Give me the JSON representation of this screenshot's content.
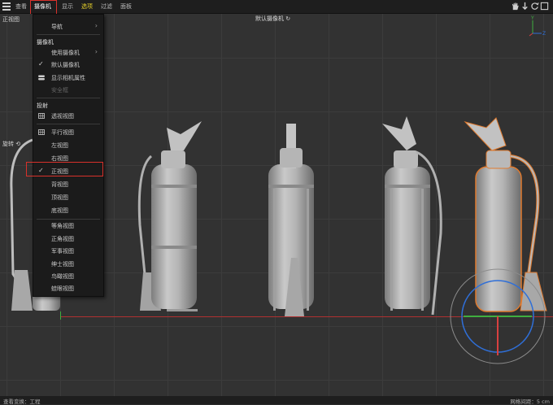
{
  "menubar": {
    "items": [
      "查看",
      "摄像机",
      "显示",
      "选项",
      "过滤",
      "面板"
    ],
    "active_index": 1
  },
  "viewport": {
    "view_name": "正视图",
    "camera_name": "默认摄像机",
    "rotate_label": "旋转",
    "gizmo_y": "Y",
    "gizmo_z": "Z"
  },
  "dropdown": {
    "nav": "导航",
    "camera_header": "摄像机",
    "use_camera": "使用摄像机",
    "default_camera": "默认摄像机",
    "show_camera_props": "显示相机属性",
    "safe_frame": "安全框",
    "projection_header": "投射",
    "perspective": "透视视图",
    "parallel": "平行视图",
    "left": "左视图",
    "right": "右视图",
    "front": "正视图",
    "back": "背视图",
    "top": "顶视图",
    "bottom": "底视图",
    "isometric": "等角视图",
    "dimetric": "正角视图",
    "military": "军事视图",
    "gentleman": "绅士视图",
    "bird": "鸟瞰视图",
    "frog": "蛙眼视图"
  },
  "statusbar": {
    "left": "查看变换：工程",
    "right": "网格间距：5 cm"
  },
  "colors": {
    "highlight_red": "#d9312b",
    "selection_orange": "#e07a2e",
    "axis_red": "#b03030",
    "axis_green": "#3fae3f",
    "axis_blue": "#2f6fd8"
  }
}
